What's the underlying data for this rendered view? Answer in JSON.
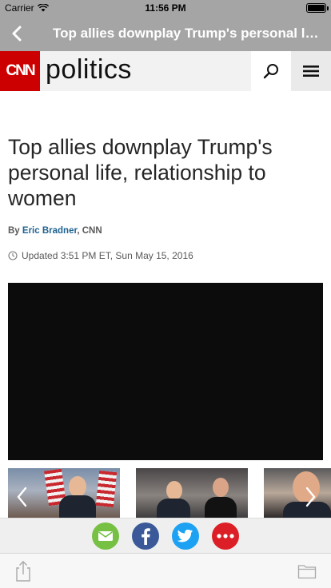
{
  "status_bar": {
    "carrier": "Carrier",
    "time": "11:56 PM",
    "wifi_icon": "wifi-icon",
    "battery_icon": "battery-icon",
    "battery_level": 1.0
  },
  "nav": {
    "back_icon": "chevron-left-icon",
    "title": "Top allies downplay Trump's personal life, relationship to women"
  },
  "header": {
    "logo_text": "CNN",
    "section": "politics",
    "search_icon": "search-icon",
    "menu_icon": "hamburger-menu-icon",
    "colors": {
      "brand_red": "#cc0000",
      "header_bg": "#f2f2f2"
    }
  },
  "article": {
    "headline": "Top allies downplay Trump's personal life, relationship to women",
    "byline_prefix": "By",
    "author": "Eric Bradner",
    "source": ", CNN",
    "updated": "Updated 3:51 PM ET, Sun May 15, 2016",
    "clock_icon": "clock-icon",
    "author_color": "#1f6391"
  },
  "gallery": {
    "prev_icon": "chevron-left-icon",
    "next_icon": "chevron-right-icon"
  },
  "share": {
    "buttons": [
      {
        "icon": "email-icon",
        "color": "#76c043"
      },
      {
        "icon": "facebook-icon",
        "color": "#3b5998"
      },
      {
        "icon": "twitter-icon",
        "color": "#1da1f2"
      },
      {
        "icon": "more-icon",
        "color": "#dc1f26"
      }
    ]
  },
  "toolbar": {
    "share_icon": "share-action-icon",
    "folder_icon": "folder-icon"
  }
}
